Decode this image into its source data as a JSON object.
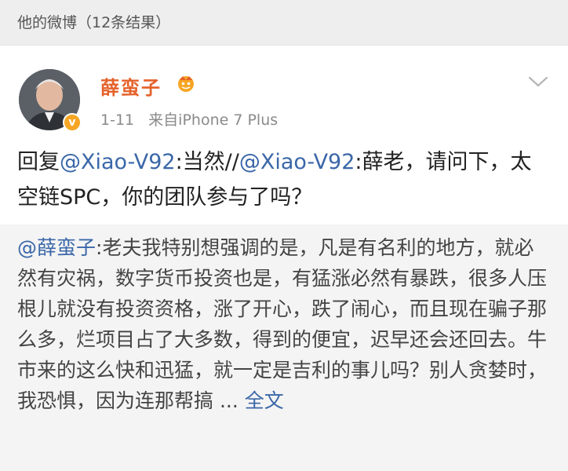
{
  "header": {
    "results_title": "他的微博（12条结果）"
  },
  "post": {
    "username": "薛蛮子",
    "vip_badge_icon": "vip-crown-icon",
    "verified_icon": "verified-v-icon",
    "time": "1-11",
    "source": "来自iPhone 7 Plus",
    "dropdown_icon": "chevron-down-icon",
    "reply_prefix": "回复",
    "mention_1": "@Xiao-V92",
    "reply_text": ":当然//",
    "mention_2": "@Xiao-V92",
    "question_text": ":薛老，请问下，太空链SPC，你的团队参与了吗？"
  },
  "repost": {
    "mention": "@薛蛮子",
    "text": ":老夫我特别想强调的是，凡是有名利的地方，就必然有灾祸，数字货币投资也是，有猛涨必然有暴跌，很多人压根儿就没有投资资格，涨了开心，跌了闹心，而且现在骗子那么多，烂项目占了大多数，得到的便宜，迟早还会还回去。牛市来的这么快和迅猛，就一定是吉利的事儿吗？别人贪婪时，我恐惧，因为连那帮搞 ... ",
    "full_text_link": "全文"
  },
  "colors": {
    "username": "#e5612a",
    "mention": "#3a67a8",
    "header_bg": "#eeeeee",
    "repost_bg": "#f4f4f4"
  }
}
